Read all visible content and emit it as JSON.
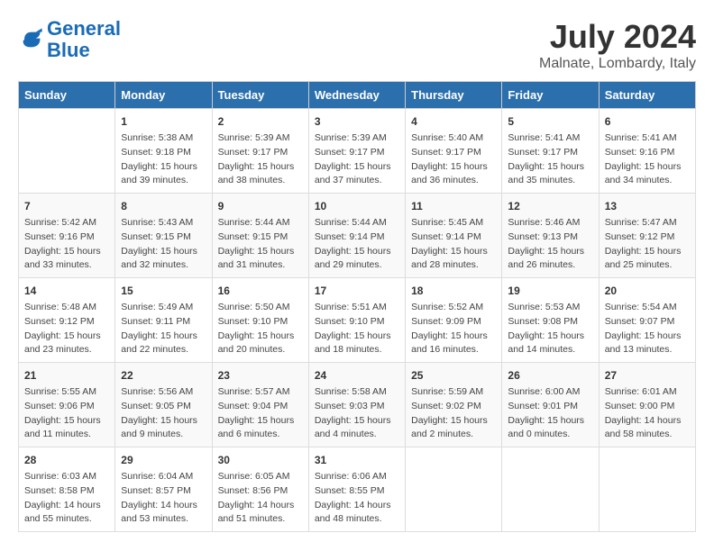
{
  "header": {
    "logo_line1": "General",
    "logo_line2": "Blue",
    "month": "July 2024",
    "location": "Malnate, Lombardy, Italy"
  },
  "weekdays": [
    "Sunday",
    "Monday",
    "Tuesday",
    "Wednesday",
    "Thursday",
    "Friday",
    "Saturday"
  ],
  "weeks": [
    [
      {
        "day": "",
        "info": ""
      },
      {
        "day": "1",
        "info": "Sunrise: 5:38 AM\nSunset: 9:18 PM\nDaylight: 15 hours\nand 39 minutes."
      },
      {
        "day": "2",
        "info": "Sunrise: 5:39 AM\nSunset: 9:17 PM\nDaylight: 15 hours\nand 38 minutes."
      },
      {
        "day": "3",
        "info": "Sunrise: 5:39 AM\nSunset: 9:17 PM\nDaylight: 15 hours\nand 37 minutes."
      },
      {
        "day": "4",
        "info": "Sunrise: 5:40 AM\nSunset: 9:17 PM\nDaylight: 15 hours\nand 36 minutes."
      },
      {
        "day": "5",
        "info": "Sunrise: 5:41 AM\nSunset: 9:17 PM\nDaylight: 15 hours\nand 35 minutes."
      },
      {
        "day": "6",
        "info": "Sunrise: 5:41 AM\nSunset: 9:16 PM\nDaylight: 15 hours\nand 34 minutes."
      }
    ],
    [
      {
        "day": "7",
        "info": "Sunrise: 5:42 AM\nSunset: 9:16 PM\nDaylight: 15 hours\nand 33 minutes."
      },
      {
        "day": "8",
        "info": "Sunrise: 5:43 AM\nSunset: 9:15 PM\nDaylight: 15 hours\nand 32 minutes."
      },
      {
        "day": "9",
        "info": "Sunrise: 5:44 AM\nSunset: 9:15 PM\nDaylight: 15 hours\nand 31 minutes."
      },
      {
        "day": "10",
        "info": "Sunrise: 5:44 AM\nSunset: 9:14 PM\nDaylight: 15 hours\nand 29 minutes."
      },
      {
        "day": "11",
        "info": "Sunrise: 5:45 AM\nSunset: 9:14 PM\nDaylight: 15 hours\nand 28 minutes."
      },
      {
        "day": "12",
        "info": "Sunrise: 5:46 AM\nSunset: 9:13 PM\nDaylight: 15 hours\nand 26 minutes."
      },
      {
        "day": "13",
        "info": "Sunrise: 5:47 AM\nSunset: 9:12 PM\nDaylight: 15 hours\nand 25 minutes."
      }
    ],
    [
      {
        "day": "14",
        "info": "Sunrise: 5:48 AM\nSunset: 9:12 PM\nDaylight: 15 hours\nand 23 minutes."
      },
      {
        "day": "15",
        "info": "Sunrise: 5:49 AM\nSunset: 9:11 PM\nDaylight: 15 hours\nand 22 minutes."
      },
      {
        "day": "16",
        "info": "Sunrise: 5:50 AM\nSunset: 9:10 PM\nDaylight: 15 hours\nand 20 minutes."
      },
      {
        "day": "17",
        "info": "Sunrise: 5:51 AM\nSunset: 9:10 PM\nDaylight: 15 hours\nand 18 minutes."
      },
      {
        "day": "18",
        "info": "Sunrise: 5:52 AM\nSunset: 9:09 PM\nDaylight: 15 hours\nand 16 minutes."
      },
      {
        "day": "19",
        "info": "Sunrise: 5:53 AM\nSunset: 9:08 PM\nDaylight: 15 hours\nand 14 minutes."
      },
      {
        "day": "20",
        "info": "Sunrise: 5:54 AM\nSunset: 9:07 PM\nDaylight: 15 hours\nand 13 minutes."
      }
    ],
    [
      {
        "day": "21",
        "info": "Sunrise: 5:55 AM\nSunset: 9:06 PM\nDaylight: 15 hours\nand 11 minutes."
      },
      {
        "day": "22",
        "info": "Sunrise: 5:56 AM\nSunset: 9:05 PM\nDaylight: 15 hours\nand 9 minutes."
      },
      {
        "day": "23",
        "info": "Sunrise: 5:57 AM\nSunset: 9:04 PM\nDaylight: 15 hours\nand 6 minutes."
      },
      {
        "day": "24",
        "info": "Sunrise: 5:58 AM\nSunset: 9:03 PM\nDaylight: 15 hours\nand 4 minutes."
      },
      {
        "day": "25",
        "info": "Sunrise: 5:59 AM\nSunset: 9:02 PM\nDaylight: 15 hours\nand 2 minutes."
      },
      {
        "day": "26",
        "info": "Sunrise: 6:00 AM\nSunset: 9:01 PM\nDaylight: 15 hours\nand 0 minutes."
      },
      {
        "day": "27",
        "info": "Sunrise: 6:01 AM\nSunset: 9:00 PM\nDaylight: 14 hours\nand 58 minutes."
      }
    ],
    [
      {
        "day": "28",
        "info": "Sunrise: 6:03 AM\nSunset: 8:58 PM\nDaylight: 14 hours\nand 55 minutes."
      },
      {
        "day": "29",
        "info": "Sunrise: 6:04 AM\nSunset: 8:57 PM\nDaylight: 14 hours\nand 53 minutes."
      },
      {
        "day": "30",
        "info": "Sunrise: 6:05 AM\nSunset: 8:56 PM\nDaylight: 14 hours\nand 51 minutes."
      },
      {
        "day": "31",
        "info": "Sunrise: 6:06 AM\nSunset: 8:55 PM\nDaylight: 14 hours\nand 48 minutes."
      },
      {
        "day": "",
        "info": ""
      },
      {
        "day": "",
        "info": ""
      },
      {
        "day": "",
        "info": ""
      }
    ]
  ]
}
